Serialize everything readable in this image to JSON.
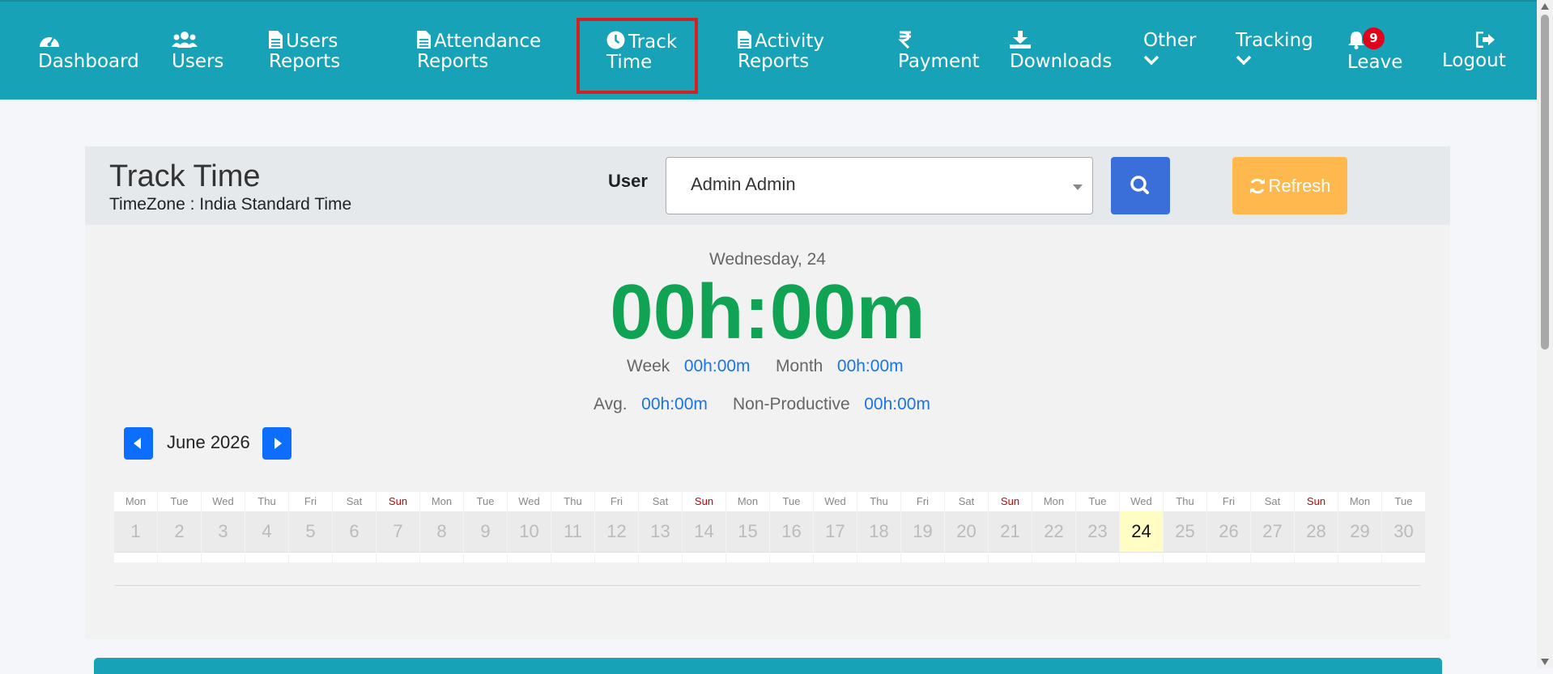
{
  "nav": {
    "items": [
      {
        "label1": "",
        "label2": "Dashboard",
        "icon": "dashboard-icon"
      },
      {
        "label1": "",
        "label2": "Users",
        "icon": "users-icon"
      },
      {
        "label1": "Users",
        "label2": "Reports",
        "icon": "file-icon"
      },
      {
        "label1": "Attendance",
        "label2": "Reports",
        "icon": "file-icon"
      },
      {
        "label1": "Track",
        "label2": "Time",
        "icon": "clock-icon"
      },
      {
        "label1": "Activity",
        "label2": "Reports",
        "icon": "file-icon"
      },
      {
        "label1": "",
        "label2": "Payment",
        "icon": "rupee-icon"
      },
      {
        "label1": "",
        "label2": "Downloads",
        "icon": "download-icon"
      },
      {
        "label1": "Other",
        "label2": "",
        "icon": "chevron-down-icon"
      },
      {
        "label1": "Tracking",
        "label2": "",
        "icon": "chevron-down-icon"
      },
      {
        "label1": "",
        "label2": "Leave",
        "icon": "bell-icon"
      },
      {
        "label1": "",
        "label2": "Logout",
        "icon": "logout-icon"
      }
    ],
    "leave_badge": "9",
    "active": "Track Time"
  },
  "header": {
    "title": "Track Time",
    "timezone": "TimeZone : India Standard Time",
    "user_label": "User",
    "user_value": "Admin Admin",
    "refresh_label": "Refresh"
  },
  "summary": {
    "day": "Wednesday, 24",
    "total": "00h:00m",
    "week_label": "Week",
    "week_value": "00h:00m",
    "month_label": "Month",
    "month_value": "00h:00m",
    "avg_label": "Avg.",
    "avg_value": "00h:00m",
    "nonprod_label": "Non-Productive",
    "nonprod_value": "00h:00m"
  },
  "calendar": {
    "month": "June 2026",
    "today": 24,
    "days": [
      {
        "d": "Mon",
        "n": "1"
      },
      {
        "d": "Tue",
        "n": "2"
      },
      {
        "d": "Wed",
        "n": "3"
      },
      {
        "d": "Thu",
        "n": "4"
      },
      {
        "d": "Fri",
        "n": "5"
      },
      {
        "d": "Sat",
        "n": "6"
      },
      {
        "d": "Sun",
        "n": "7"
      },
      {
        "d": "Mon",
        "n": "8"
      },
      {
        "d": "Tue",
        "n": "9"
      },
      {
        "d": "Wed",
        "n": "10"
      },
      {
        "d": "Thu",
        "n": "11"
      },
      {
        "d": "Fri",
        "n": "12"
      },
      {
        "d": "Sat",
        "n": "13"
      },
      {
        "d": "Sun",
        "n": "14"
      },
      {
        "d": "Mon",
        "n": "15"
      },
      {
        "d": "Tue",
        "n": "16"
      },
      {
        "d": "Wed",
        "n": "17"
      },
      {
        "d": "Thu",
        "n": "18"
      },
      {
        "d": "Fri",
        "n": "19"
      },
      {
        "d": "Sat",
        "n": "20"
      },
      {
        "d": "Sun",
        "n": "21"
      },
      {
        "d": "Mon",
        "n": "22"
      },
      {
        "d": "Tue",
        "n": "23"
      },
      {
        "d": "Wed",
        "n": "24"
      },
      {
        "d": "Thu",
        "n": "25"
      },
      {
        "d": "Fri",
        "n": "26"
      },
      {
        "d": "Sat",
        "n": "27"
      },
      {
        "d": "Sun",
        "n": "28"
      },
      {
        "d": "Mon",
        "n": "29"
      },
      {
        "d": "Tue",
        "n": "30"
      }
    ]
  },
  "colors": {
    "nav_bg": "#17a2b8",
    "total_green": "#10a354",
    "link_blue": "#1a73e8",
    "search_blue": "#3a6ed8",
    "refresh_orange": "#ffb84d",
    "sunday_red": "#cc0000",
    "today_yellow": "#fffcc4"
  }
}
